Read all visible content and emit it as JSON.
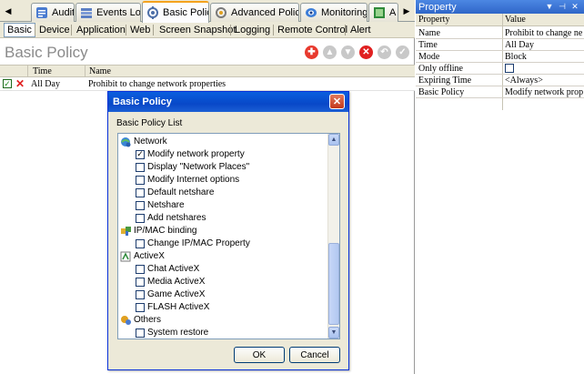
{
  "tabs": [
    {
      "label": "Audit",
      "icon": "audit-icon"
    },
    {
      "label": "Events Log",
      "icon": "events-log-icon"
    },
    {
      "label": "Basic Policy",
      "icon": "basic-policy-icon",
      "active": true
    },
    {
      "label": "Advanced Policy",
      "icon": "advanced-policy-icon"
    },
    {
      "label": "Monitoring",
      "icon": "monitoring-icon"
    },
    {
      "label": "A",
      "icon": "assets-icon"
    }
  ],
  "subtabs": [
    "Basic",
    "Device",
    "Application",
    "Web",
    "Screen Snapshot",
    "Logging",
    "Remote Control",
    "Alert"
  ],
  "page_title": "Basic Policy",
  "toolbar_icons": [
    "add-icon",
    "up-icon",
    "down-icon",
    "delete-icon",
    "undo-icon",
    "apply-icon"
  ],
  "grid": {
    "headers": {
      "time": "Time",
      "name": "Name"
    },
    "rows": [
      {
        "enabled": true,
        "action": "block",
        "time": "All Day",
        "name": "Prohibit to change network properties"
      }
    ]
  },
  "property_panel": {
    "title": "Property",
    "headers": {
      "property": "Property",
      "value": "Value"
    },
    "rows": [
      {
        "property": "Name",
        "value": "Prohibit to change ne..."
      },
      {
        "property": "Time",
        "value": "All Day"
      },
      {
        "property": "Mode",
        "value": "Block"
      },
      {
        "property": "Only offline",
        "value": ""
      },
      {
        "property": "Expiring Time",
        "value": "<Always>"
      },
      {
        "property": "Basic Policy",
        "value": "Modify network prop ..."
      }
    ]
  },
  "dialog": {
    "title": "Basic Policy",
    "list_label": "Basic Policy List",
    "groups": [
      {
        "label": "Network",
        "icon": "network-icon",
        "items": [
          {
            "label": "Modify network property",
            "checked": true
          },
          {
            "label": "Display \"Network Places\"",
            "checked": false
          },
          {
            "label": "Modify Internet options",
            "checked": false
          },
          {
            "label": "Default netshare",
            "checked": false
          },
          {
            "label": "Netshare",
            "checked": false
          },
          {
            "label": "Add netshares",
            "checked": false
          }
        ]
      },
      {
        "label": "IP/MAC binding",
        "icon": "ip-mac-binding-icon",
        "items": [
          {
            "label": "Change IP/MAC Property",
            "checked": false
          }
        ]
      },
      {
        "label": "ActiveX",
        "icon": "activex-icon",
        "items": [
          {
            "label": "Chat ActiveX",
            "checked": false
          },
          {
            "label": "Media ActiveX",
            "checked": false
          },
          {
            "label": "Game ActiveX",
            "checked": false
          },
          {
            "label": "FLASH ActiveX",
            "checked": false
          }
        ]
      },
      {
        "label": "Others",
        "icon": "others-icon",
        "items": [
          {
            "label": "System restore",
            "checked": false
          }
        ]
      }
    ],
    "ok_label": "OK",
    "cancel_label": "Cancel"
  },
  "colors": {
    "xp_title_blue": "#0848c8",
    "active_tab_accent": "#f4a21d",
    "delete_red": "#e02020",
    "add_red": "#e83a2e",
    "toolbar_disabled": "#c8c8c8"
  }
}
